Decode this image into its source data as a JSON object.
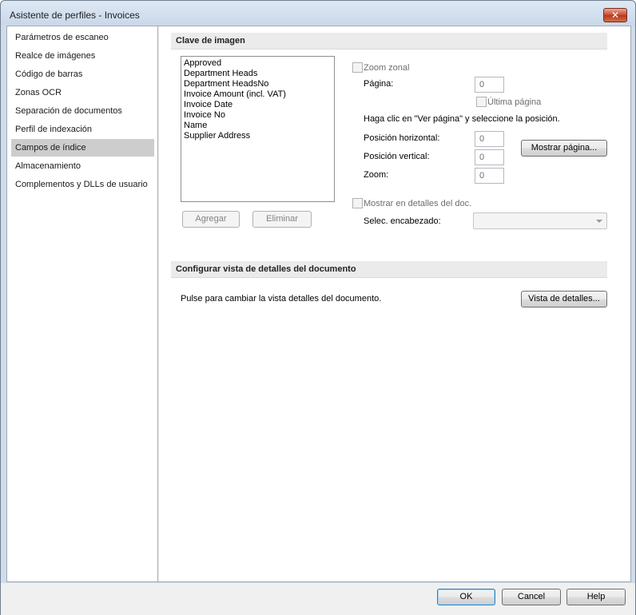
{
  "window": {
    "title": "Asistente de perfiles - Invoices",
    "close_glyph": "✕"
  },
  "sidebar": {
    "items": [
      {
        "label": "Parámetros de escaneo"
      },
      {
        "label": "Realce de imágenes"
      },
      {
        "label": "Código de barras"
      },
      {
        "label": "Zonas OCR"
      },
      {
        "label": "Separación de documentos"
      },
      {
        "label": "Perfil de indexación"
      },
      {
        "label": "Campos de índice",
        "selected": true
      },
      {
        "label": "Almacenamiento"
      },
      {
        "label": "Complementos y DLLs de usuario"
      }
    ]
  },
  "image_key": {
    "header": "Clave de imagen",
    "fields": [
      "Approved",
      "Department Heads",
      "Department HeadsNo",
      "Invoice Amount (incl. VAT)",
      "Invoice Date",
      "Invoice No",
      "Name",
      "Supplier Address"
    ],
    "add_label": "Agregar",
    "remove_label": "Eliminar",
    "zoom_zonal_label": "Zoom zonal",
    "page_label": "Página:",
    "page_value": "0",
    "last_page_label": "Última página",
    "instruction": "Haga clic en \"Ver página\" y seleccione la posición.",
    "horizontal_label": "Posición horizontal:",
    "horizontal_value": "0",
    "vertical_label": "Posición vertical:",
    "vertical_value": "0",
    "zoom_label": "Zoom:",
    "zoom_value": "0",
    "show_page_label": "Mostrar página...",
    "show_in_details_label": "Mostrar en detalles del doc.",
    "select_header_label": "Selec. encabezado:",
    "select_header_value": ""
  },
  "details_view": {
    "header": "Configurar vista de detalles del documento",
    "description": "Pulse para cambiar la vista detalles del documento.",
    "button_label": "Vista de detalles..."
  },
  "footer": {
    "ok_label": "OK",
    "cancel_label": "Cancel",
    "help_label": "Help"
  }
}
